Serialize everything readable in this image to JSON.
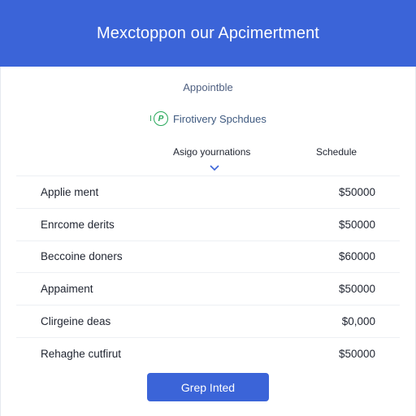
{
  "header": {
    "title": "Mexctoppon our Apcimertment"
  },
  "main": {
    "subtitle": "Appointble",
    "filter_label": "Firotivery Spchdues",
    "filter_icon": "P",
    "filter_tick": "I",
    "columns": {
      "left": "Asigo yournations",
      "right": "Schedule"
    },
    "rows": [
      {
        "label": "Applie ment",
        "value": "$50000"
      },
      {
        "label": "Enrcome derits",
        "value": "$50000"
      },
      {
        "label": "Beccoine doners",
        "value": "$60000"
      },
      {
        "label": "Appaiment",
        "value": "$50000"
      },
      {
        "label": "Clirgeine deas",
        "value": "$0,000"
      },
      {
        "label": "Rehaghe cutfirut",
        "value": "$50000"
      }
    ],
    "button_label": "Grep Inted"
  },
  "colors": {
    "accent": "#3b64d8",
    "filter_icon": "#27a85a"
  },
  "icons": {
    "filter": "p-circle-icon",
    "dropdown": "chevron-down-icon"
  }
}
